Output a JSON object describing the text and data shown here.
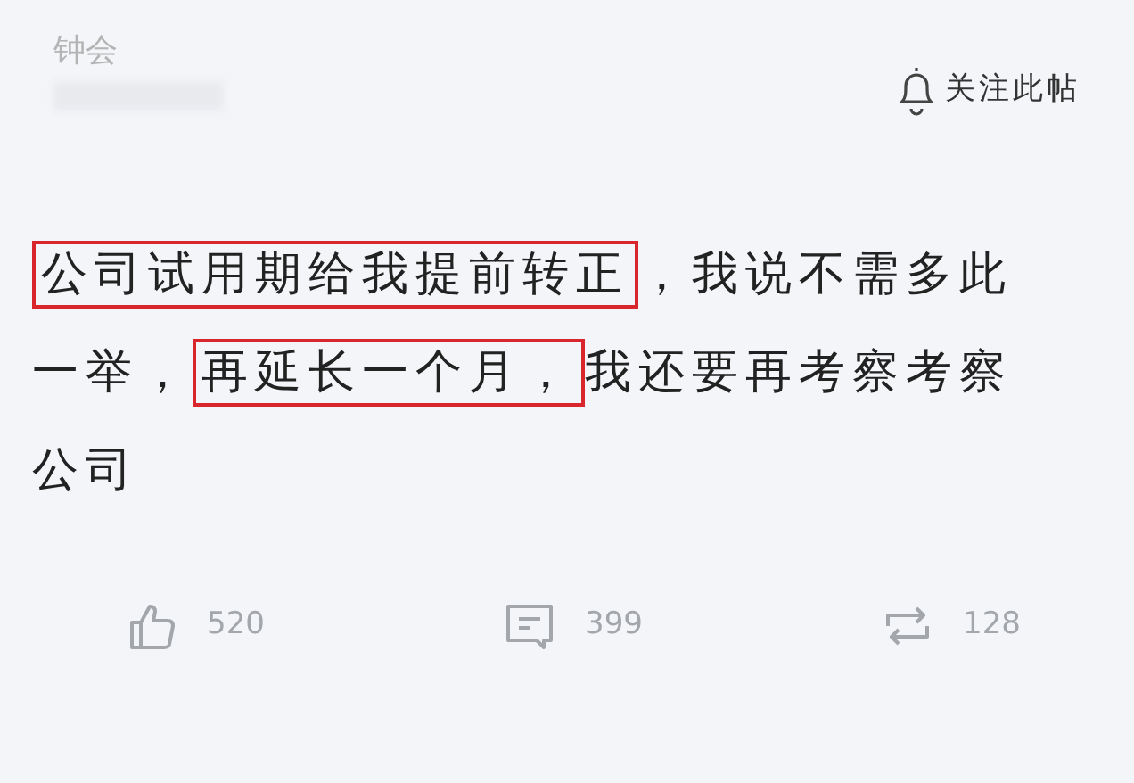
{
  "author": {
    "name": "钟会"
  },
  "follow": {
    "label": "关注此帖"
  },
  "post": {
    "segments": [
      {
        "text": "公司试用期给我提前转正",
        "highlighted": true
      },
      {
        "text": "，我说不需多此",
        "highlighted": false
      },
      {
        "text": "一举，",
        "highlighted": false
      },
      {
        "text": "再延长一个月，",
        "highlighted": true
      },
      {
        "text": "我还要再考察考察",
        "highlighted": false
      },
      {
        "text": "公司",
        "highlighted": false
      }
    ]
  },
  "actions": [
    {
      "kind": "like",
      "count": "520"
    },
    {
      "kind": "comment",
      "count": "399"
    },
    {
      "kind": "repost",
      "count": "128"
    }
  ]
}
